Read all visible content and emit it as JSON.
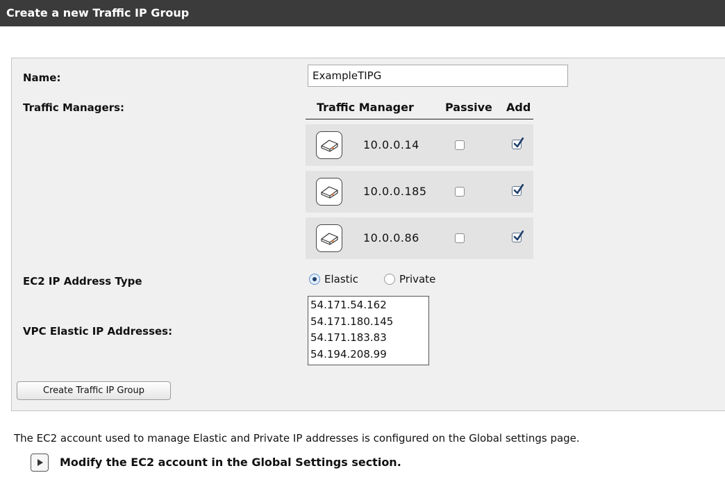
{
  "header": {
    "title": "Create a new Traffic IP Group"
  },
  "form": {
    "name_label": "Name:",
    "name_value": "ExampleTIPG",
    "tm_label": "Traffic Managers:",
    "tm_columns": {
      "manager": "Traffic Manager",
      "passive": "Passive",
      "add": "Add"
    },
    "traffic_managers": [
      {
        "ip": "10.0.0.14",
        "passive": false,
        "add": true,
        "icon": "server-icon"
      },
      {
        "ip": "10.0.0.185",
        "passive": false,
        "add": true,
        "icon": "server-icon"
      },
      {
        "ip": "10.0.0.86",
        "passive": false,
        "add": true,
        "icon": "server-icon"
      }
    ],
    "ec2_type_label": "EC2 IP Address Type",
    "ec2_type_options": {
      "elastic": "Elastic",
      "private": "Private"
    },
    "ec2_type_selected": "Elastic",
    "vpc_label": "VPC Elastic IP Addresses:",
    "vpc_addresses": [
      "54.171.54.162",
      "54.171.180.145",
      "54.171.183.83",
      "54.194.208.99"
    ],
    "submit_label": "Create Traffic IP Group"
  },
  "footer": {
    "info_text": "The EC2 account used to manage Elastic and Private IP addresses is configured on the Global settings page.",
    "link_text": "Modify the EC2 account in the Global Settings section."
  },
  "colors": {
    "titlebar": "#3b3b3b",
    "panel": "#f0f0f0",
    "checkmark": "#1f3f6b",
    "device_accent": "#e8742a"
  }
}
